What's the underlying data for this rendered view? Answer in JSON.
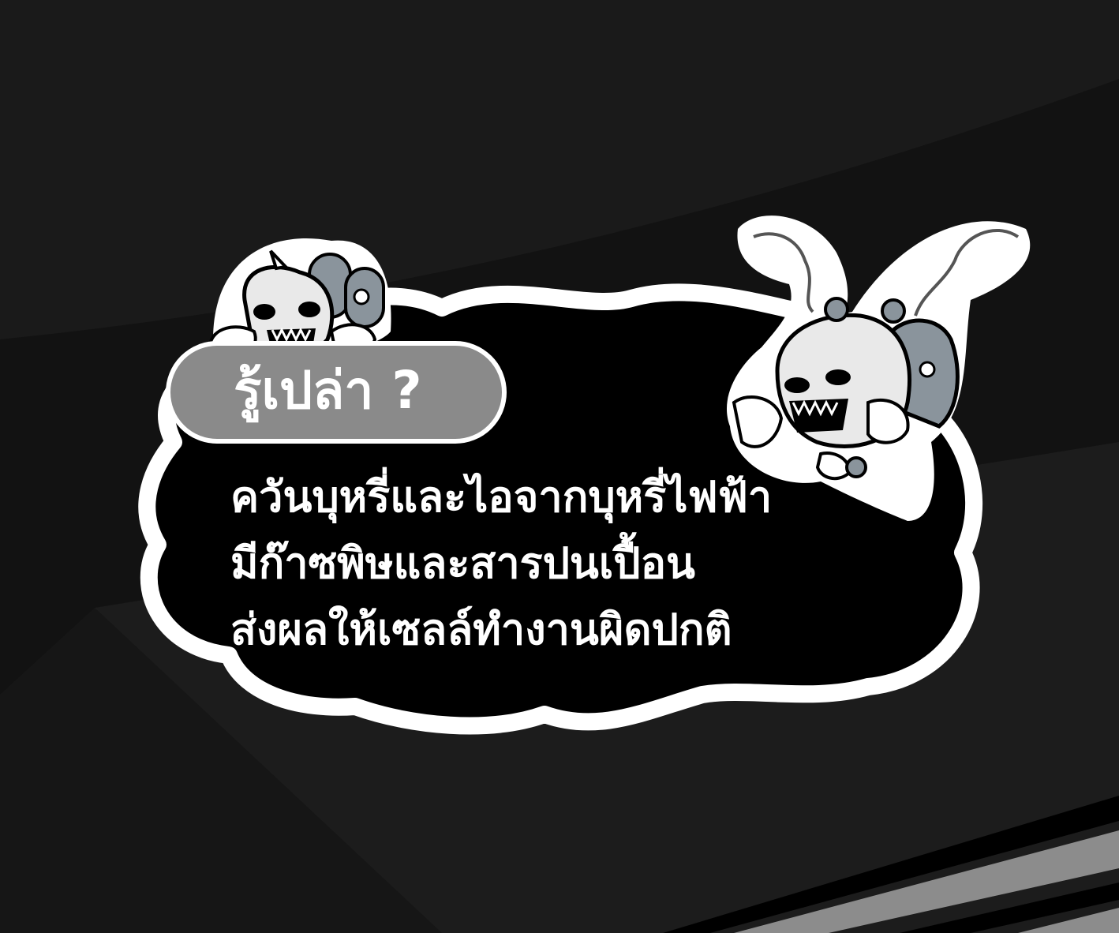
{
  "badge": {
    "label": "รู้เปล่า ?"
  },
  "message": {
    "lines": [
      "ควันบุหรี่และไอจากบุหรี่ไฟฟ้า",
      "มีก๊าซพิษและสารปนเปื้อน",
      "ส่งผลให้เซลล์ทำงานผิดปกติ"
    ]
  },
  "illustrations": {
    "left": "skull-monster-with-gravestones-icon",
    "right": "smoking-germ-monster-icon"
  },
  "colors": {
    "background": "#121212",
    "bubble": "#000000",
    "outline": "#ffffff",
    "badge": "#8a8a8a",
    "stripes": "#8c8c8c"
  }
}
